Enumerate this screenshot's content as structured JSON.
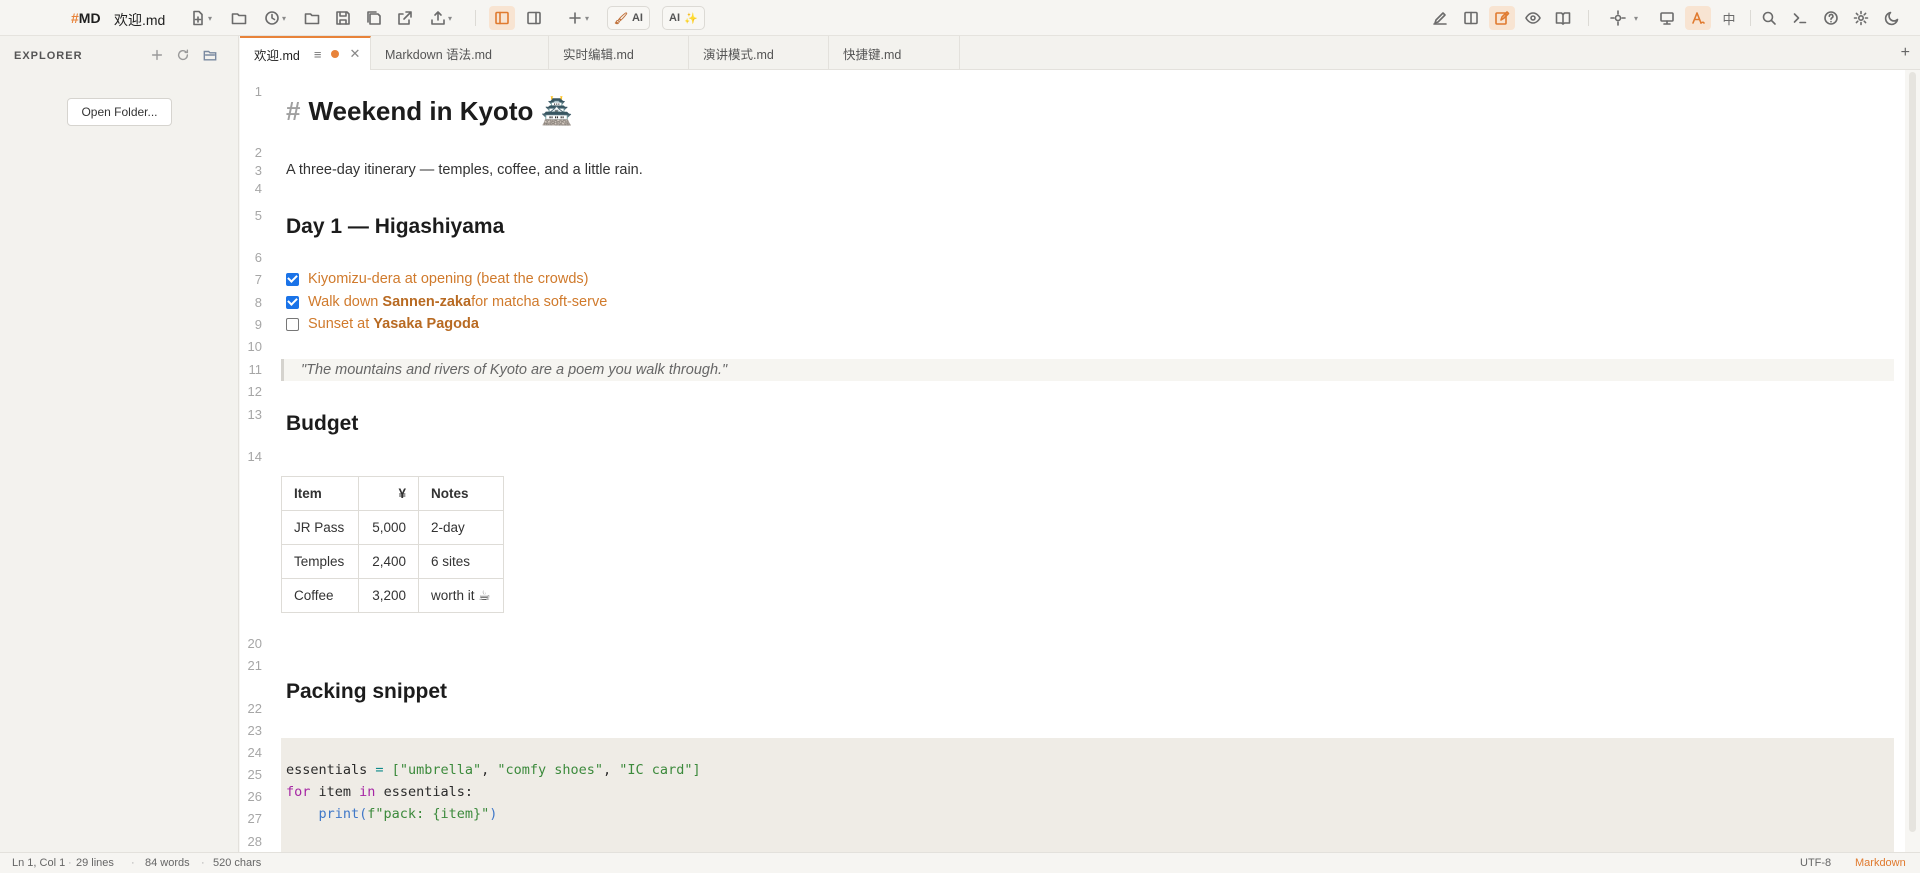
{
  "app": {
    "brand_hash": "#",
    "brand_name": "MD",
    "document_title": "欢迎.md"
  },
  "toolbar": {
    "ai_clean_label": "AI",
    "ai_magic_label": "AI",
    "lang_toggle_label": "中"
  },
  "sidebar": {
    "title": "EXPLORER",
    "open_folder_label": "Open Folder..."
  },
  "tabs": [
    {
      "label": "欢迎.md",
      "active": true,
      "modified": true
    },
    {
      "label": "Markdown 语法.md",
      "active": false
    },
    {
      "label": "实时编辑.md",
      "active": false
    },
    {
      "label": "演讲模式.md",
      "active": false
    },
    {
      "label": "快捷键.md",
      "active": false
    }
  ],
  "editor": {
    "line_numbers": [
      "1",
      "2",
      "3",
      "4",
      "5",
      "6",
      "7",
      "8",
      "9",
      "10",
      "11",
      "12",
      "13",
      "14",
      "20",
      "21",
      "22",
      "23",
      "24",
      "25",
      "26",
      "27",
      "28"
    ],
    "heading1_mark": "#",
    "heading1": "Weekend in Kyoto 🏯",
    "intro": "A three-day itinerary — temples, coffee, and a little rain.",
    "day1_heading": "Day 1 — Higashiyama",
    "tasks": [
      {
        "checked": true,
        "before": "Kiyomizu-dera at opening (beat the crowds)",
        "bold": "",
        "after": ""
      },
      {
        "checked": true,
        "before": "Walk down ",
        "bold": "Sannen-zaka",
        "after": " for matcha soft-serve"
      },
      {
        "checked": false,
        "before": "Sunset at ",
        "bold": "Yasaka Pagoda",
        "after": ""
      }
    ],
    "quote": "\"The mountains and rivers of Kyoto are a poem you walk through.\"",
    "budget_heading": "Budget",
    "budget_table": {
      "headers": [
        "Item",
        "¥",
        "Notes"
      ],
      "rows": [
        [
          "JR Pass",
          "5,000",
          "2-day"
        ],
        [
          "Temples",
          "2,400",
          "6 sites"
        ],
        [
          "Coffee",
          "3,200",
          "worth it ☕"
        ]
      ]
    },
    "packing_heading": "Packing snippet",
    "code": {
      "l1_var": "essentials",
      "l1_op": " = ",
      "l1_open": "[",
      "l1_s1": "\"umbrella\"",
      "l1_s2": "\"comfy shoes\"",
      "l1_s3": "\"IC card\"",
      "l1_close": "]",
      "l2_kw1": "for",
      "l2_var": " item ",
      "l2_kw2": "in",
      "l2_rest": " essentials:",
      "l3_fn": "print",
      "l3_str": "f\"pack: {item}\"",
      "l3_close": ")"
    }
  },
  "status": {
    "position": "Ln 1, Col 1",
    "lines": "29 lines",
    "words": "84 words",
    "chars": "520 chars",
    "encoding": "UTF-8",
    "language": "Markdown"
  },
  "colors": {
    "accent": "#e8833a",
    "checkbox": "#1a73e8",
    "task_text": "#d07a2c"
  }
}
